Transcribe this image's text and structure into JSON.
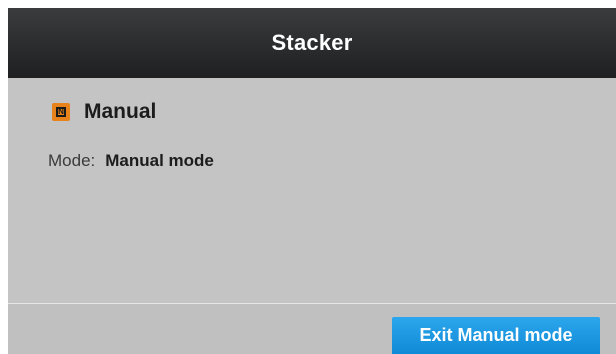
{
  "header": {
    "title": "Stacker"
  },
  "status": {
    "icon": "manual-mode-icon",
    "icon_color": "#e8821a",
    "label": "Manual"
  },
  "mode": {
    "key": "Mode:",
    "value": "Manual mode"
  },
  "footer": {
    "exit_button_label": "Exit Manual mode",
    "exit_button_color": "#1a9be2"
  }
}
